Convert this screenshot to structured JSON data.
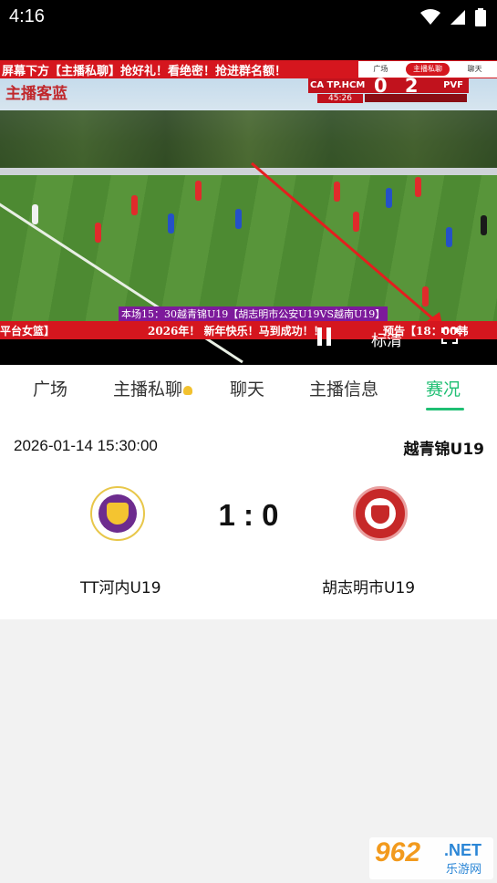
{
  "status_bar": {
    "time": "4:16"
  },
  "video": {
    "top_banner": "屏幕下方【主播私聊】抢好礼！看绝密！抢进群名额！",
    "banner_tabs": [
      "广场",
      "主播私聊",
      "聊天"
    ],
    "watermark": "主播客蓝",
    "scorebug": {
      "home": "CA TP.HCM",
      "score": "0  2",
      "away": "PVF",
      "time": "45:26"
    },
    "promo_line": "本场15：30越青锦U19【胡志明市公安U19VS越南U19】",
    "bottom_banner_left": "平台女篮】",
    "bottom_banner_mid": "2026年！ 新年快乐！马到成功！！",
    "bottom_banner_right": "预告【18：00韩",
    "quality_label": "标清"
  },
  "tabs": [
    {
      "label": "广场"
    },
    {
      "label": "主播私聊"
    },
    {
      "label": "聊天"
    },
    {
      "label": "主播信息"
    },
    {
      "label": "赛况"
    }
  ],
  "match": {
    "datetime": "2026-01-14 15:30:00",
    "league": "越青锦U19",
    "score": "1 : 0",
    "home_team": "TT河内U19",
    "away_team": "胡志明市U19"
  },
  "site_watermark": {
    "num": "962",
    "net": ".NET",
    "cn": "乐游网"
  },
  "colors": {
    "accent_green": "#1fbf73",
    "banner_red": "#d5161e"
  }
}
